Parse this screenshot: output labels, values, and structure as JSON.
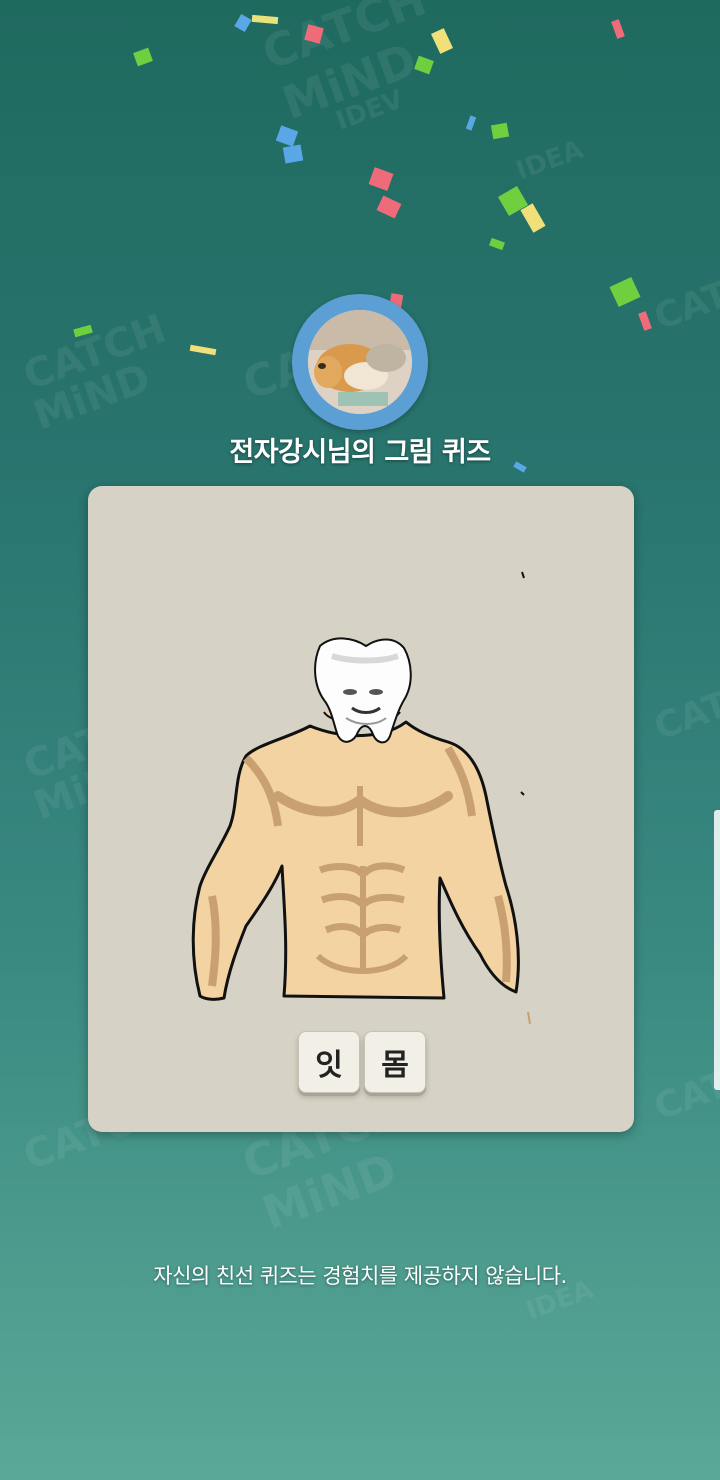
{
  "header": {
    "quiz_title": "전자강시님의 그림 퀴즈"
  },
  "avatar": {
    "icon": "shiba-dog-photo",
    "ring_color": "#5b9fd4"
  },
  "canvas": {
    "background_color": "#d6d2c5",
    "drawing_subject": "tooth-head-on-muscular-torso"
  },
  "answer": {
    "tiles": [
      "잇",
      "몸"
    ]
  },
  "footer": {
    "notice": "자신의 친선 퀴즈는 경험치를 제공하지 않습니다."
  },
  "colors": {
    "background_top": "#1f6a5f",
    "background_bottom": "#5aa896",
    "skin": "#f3d3a1",
    "skin_shade": "#c9a070"
  }
}
